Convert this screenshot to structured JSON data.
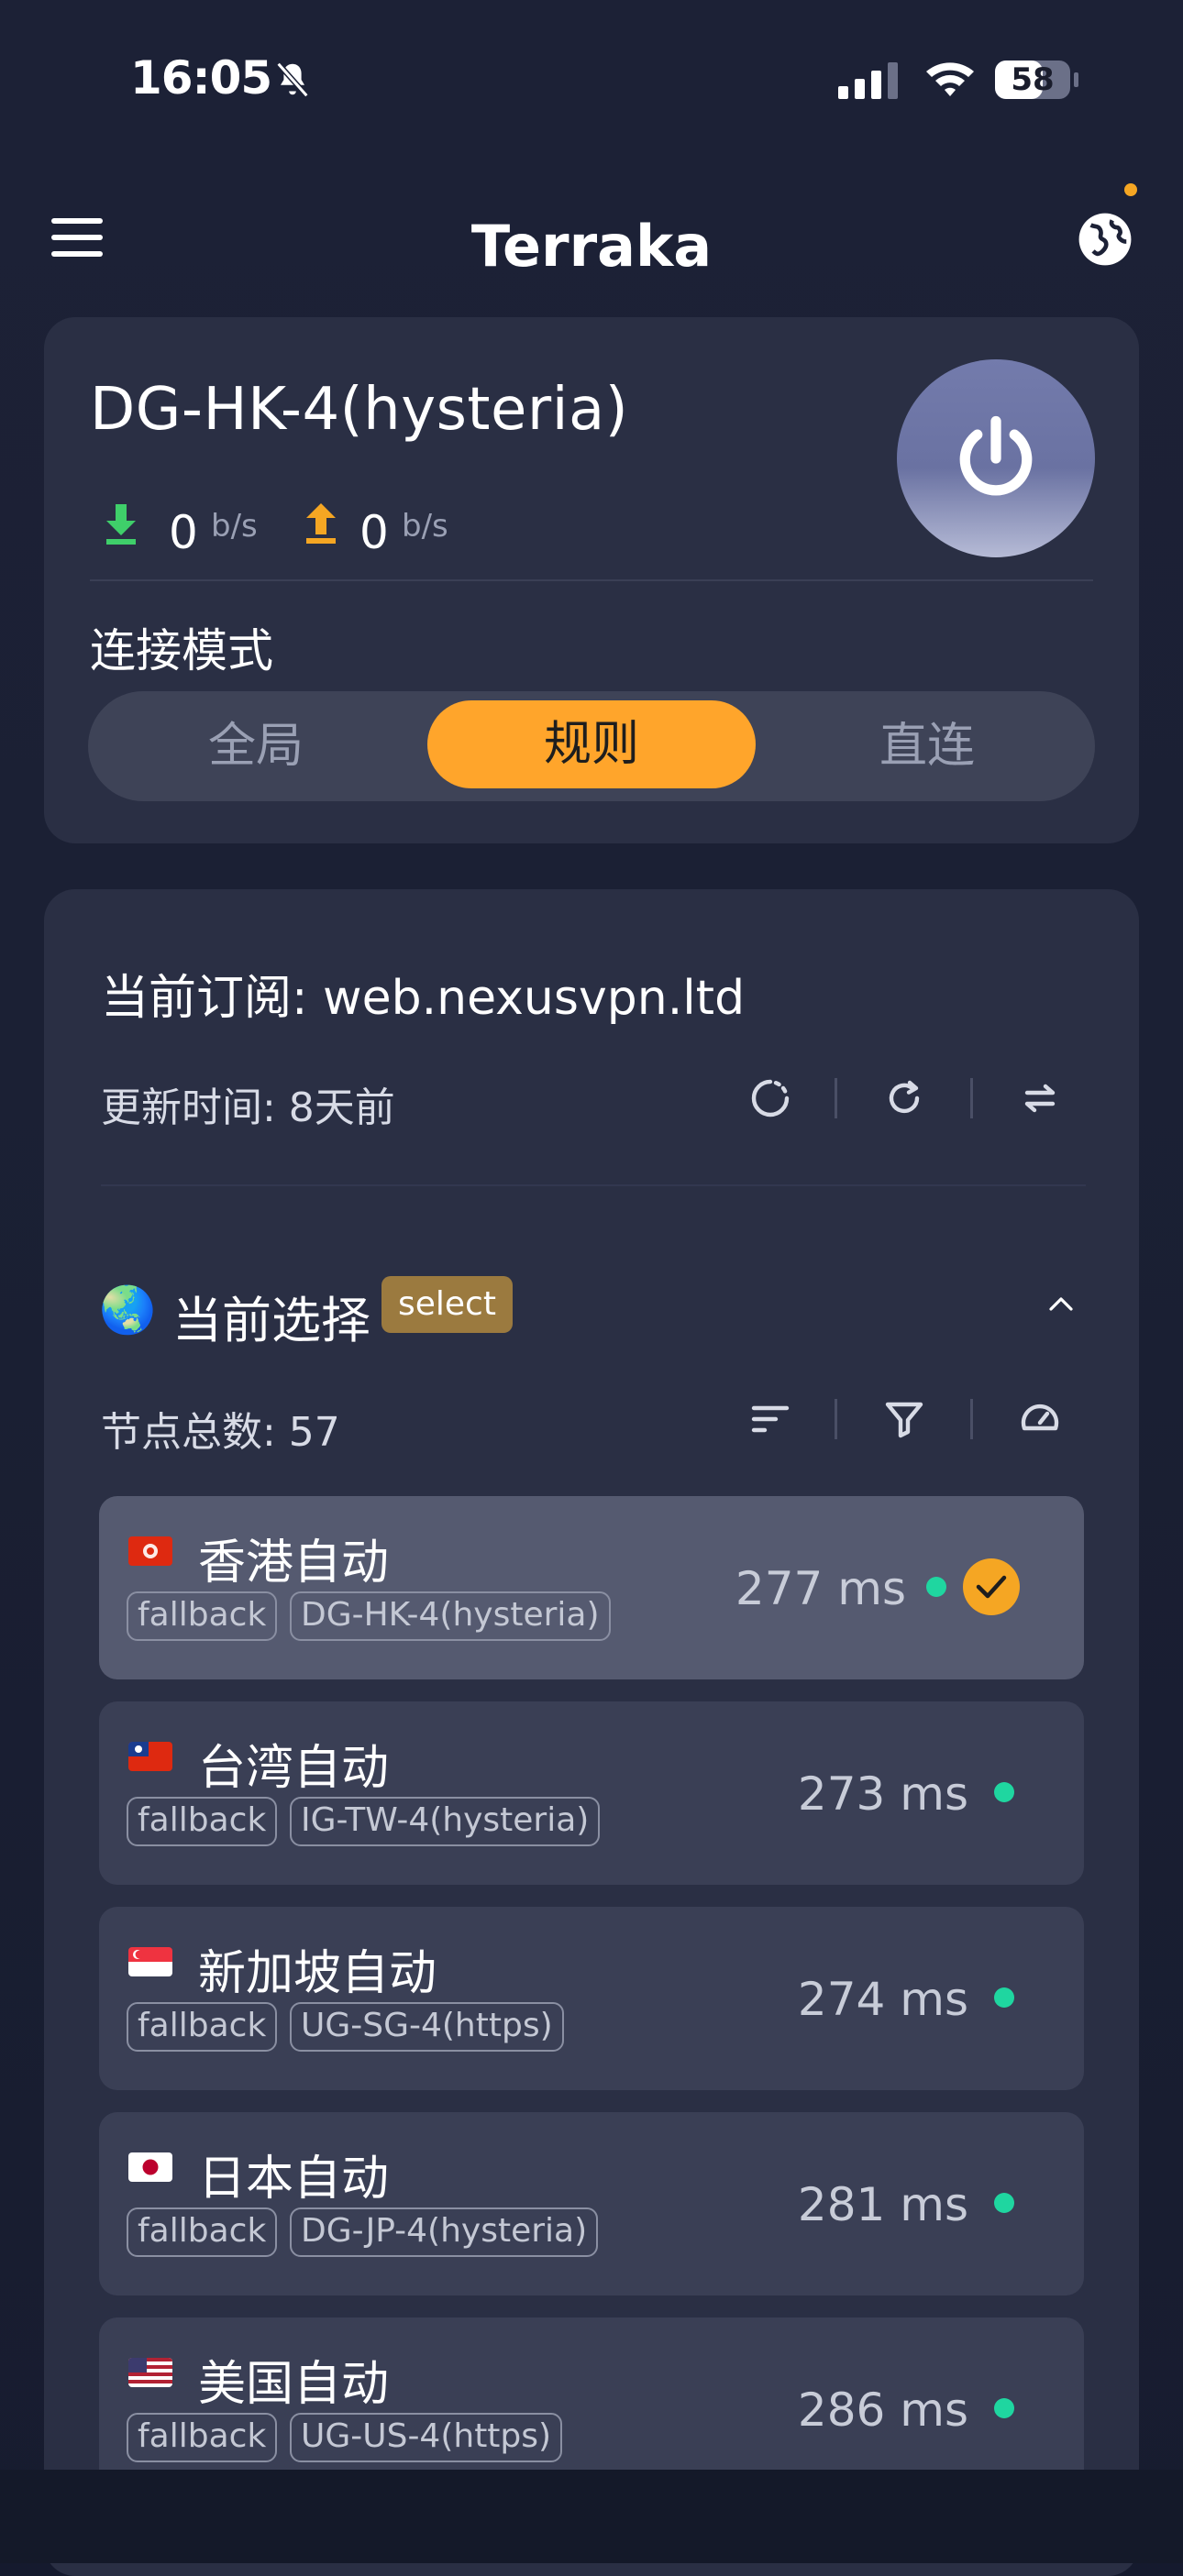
{
  "status_bar": {
    "time": "16:05",
    "battery": "58"
  },
  "header": {
    "title": "Terraka"
  },
  "connection": {
    "node_name": "DG-HK-4(hysteria)",
    "download_value": "0",
    "download_unit": "b/s",
    "upload_value": "0",
    "upload_unit": "b/s",
    "mode_label": "连接模式",
    "modes": [
      "全局",
      "规则",
      "直连"
    ],
    "selected_mode": "规则"
  },
  "subscription": {
    "title": "当前订阅: web.nexusvpn.ltd",
    "update_time": "更新时间: 8天前"
  },
  "group": {
    "emoji": "🌏",
    "title": "当前选择",
    "badge": "select",
    "node_count": "节点总数: 57"
  },
  "nodes": [
    {
      "name": "香港自动",
      "type": "fallback",
      "target": "DG-HK-4(hysteria)",
      "latency": "277 ms",
      "selected": true
    },
    {
      "name": "台湾自动",
      "type": "fallback",
      "target": "IG-TW-4(hysteria)",
      "latency": "273 ms",
      "selected": false
    },
    {
      "name": "新加坡自动",
      "type": "fallback",
      "target": "UG-SG-4(https)",
      "latency": "274 ms",
      "selected": false
    },
    {
      "name": "日本自动",
      "type": "fallback",
      "target": "DG-JP-4(hysteria)",
      "latency": "281 ms",
      "selected": false
    },
    {
      "name": "美国自动",
      "type": "fallback",
      "target": "UG-US-4(https)",
      "latency": "286 ms",
      "selected": false
    }
  ],
  "colors": {
    "accent": "#ffa52b",
    "latency_ok": "#1fd6a0",
    "card": "#2a2f44",
    "background": "#1b2034"
  }
}
